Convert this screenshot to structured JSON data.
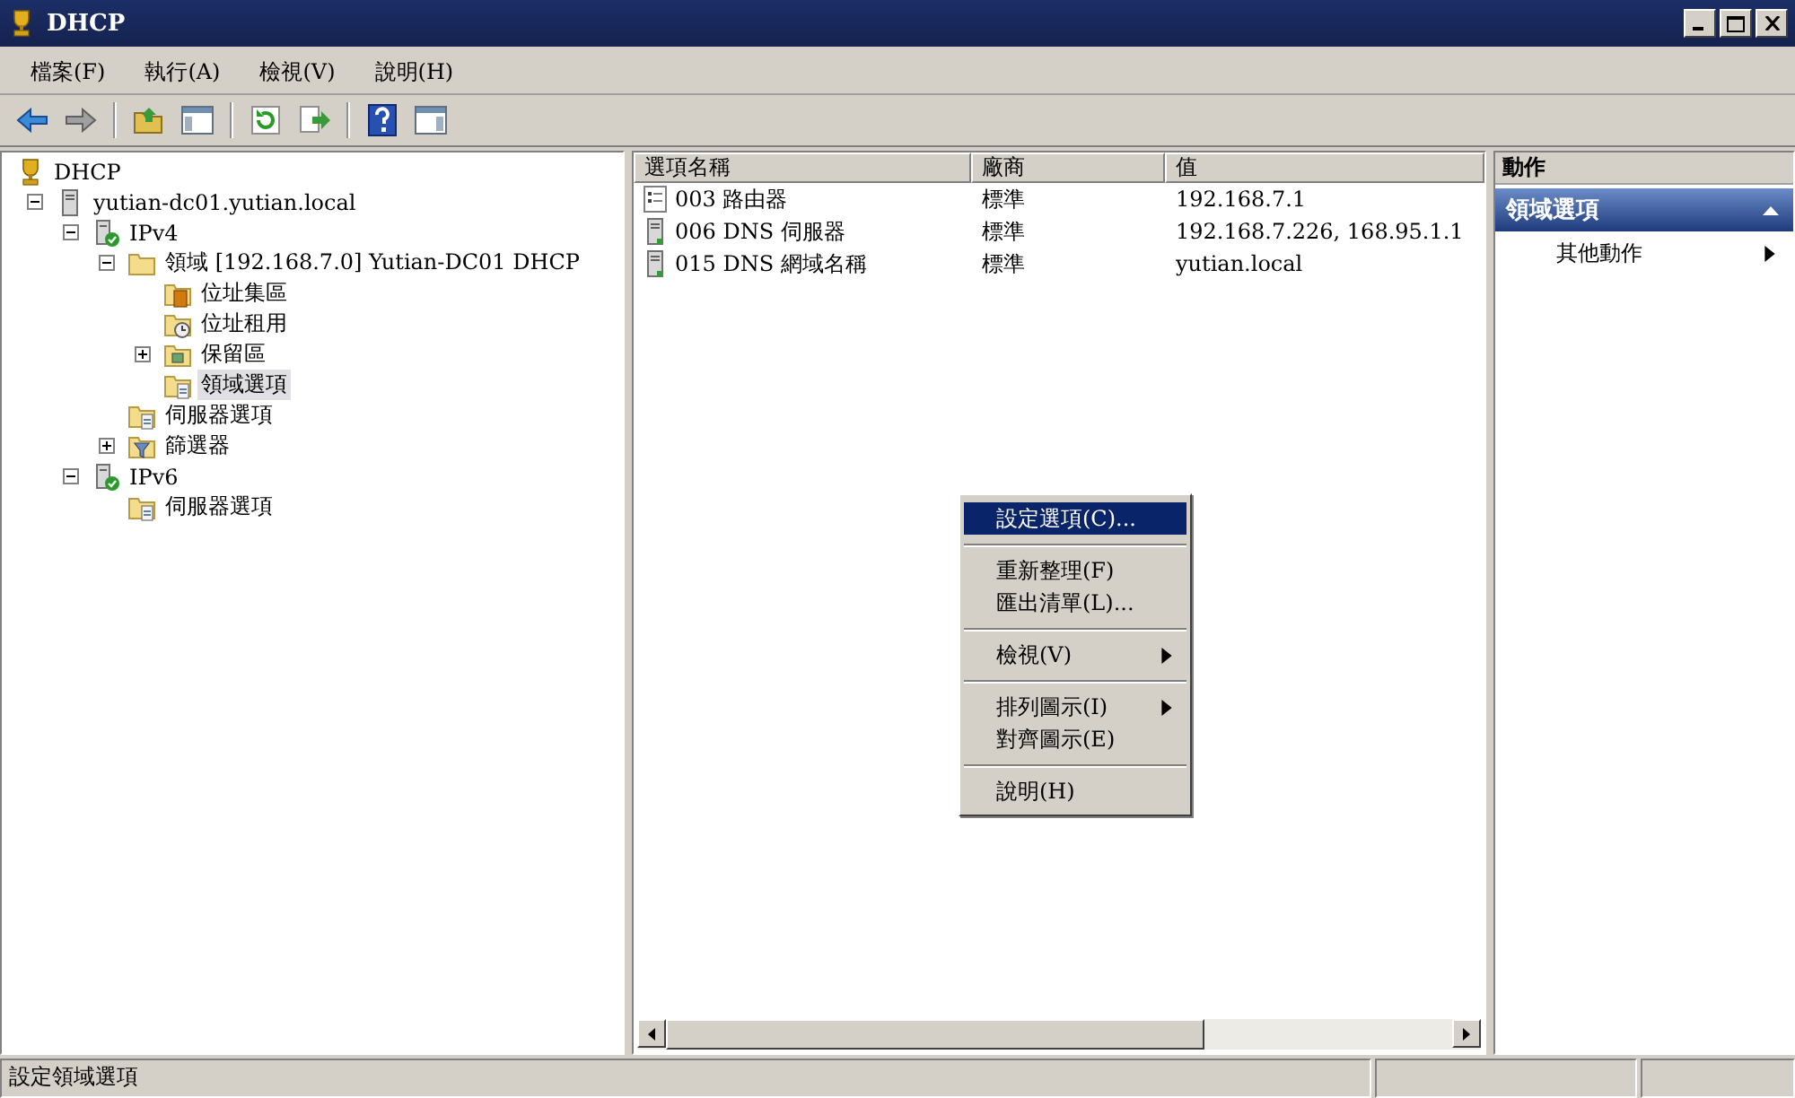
{
  "window": {
    "title": "DHCP"
  },
  "menu": [
    "檔案(F)",
    "執行(A)",
    "檢視(V)",
    "說明(H)"
  ],
  "tree": [
    {
      "label": "DHCP",
      "kind": "root",
      "selected": false,
      "children": [
        {
          "label": "yutian-dc01.yutian.local",
          "kind": "server",
          "selected": false,
          "expanded": true,
          "children": [
            {
              "label": "IPv4",
              "kind": "protocol",
              "selected": false,
              "expanded": true,
              "children": [
                {
                  "label": "領域 [192.168.7.0] Yutian-DC01 DHCP",
                  "kind": "scope",
                  "selected": false,
                  "expanded": true,
                  "children": [
                    {
                      "label": "位址集區",
                      "kind": "pool",
                      "selected": false
                    },
                    {
                      "label": "位址租用",
                      "kind": "leases",
                      "selected": false
                    },
                    {
                      "label": "保留區",
                      "kind": "reservations",
                      "selected": false,
                      "expanded": false
                    },
                    {
                      "label": "領域選項",
                      "kind": "options",
                      "selected": true
                    }
                  ]
                },
                {
                  "label": "伺服器選項",
                  "kind": "options",
                  "selected": false
                },
                {
                  "label": "篩選器",
                  "kind": "filters",
                  "selected": false,
                  "expanded": false
                }
              ]
            },
            {
              "label": "IPv6",
              "kind": "protocol",
              "selected": false,
              "expanded": true,
              "children": [
                {
                  "label": "伺服器選項",
                  "kind": "options",
                  "selected": false
                }
              ]
            }
          ]
        }
      ]
    }
  ],
  "table": {
    "columns": [
      "選項名稱",
      "廠商",
      "值"
    ],
    "rows": [
      {
        "kind": "list",
        "cells": [
          "003 路由器",
          "標準",
          "192.168.7.1"
        ]
      },
      {
        "kind": "server",
        "cells": [
          "006 DNS 伺服器",
          "標準",
          "192.168.7.226, 168.95.1.1"
        ]
      },
      {
        "kind": "server",
        "cells": [
          "015 DNS 網域名稱",
          "標準",
          "yutian.local"
        ]
      }
    ]
  },
  "context_menu": {
    "groups": [
      [
        {
          "label": "設定選項(C)...",
          "selected": true,
          "submenu": false
        }
      ],
      [
        {
          "label": "重新整理(F)",
          "selected": false,
          "submenu": false
        },
        {
          "label": "匯出清單(L)...",
          "selected": false,
          "submenu": false
        }
      ],
      [
        {
          "label": "檢視(V)",
          "selected": false,
          "submenu": true
        }
      ],
      [
        {
          "label": "排列圖示(I)",
          "selected": false,
          "submenu": true
        },
        {
          "label": "對齊圖示(E)",
          "selected": false,
          "submenu": false
        }
      ],
      [
        {
          "label": "說明(H)",
          "selected": false,
          "submenu": false
        }
      ]
    ]
  },
  "actions": {
    "title": "動作",
    "section": {
      "label": "領域選項",
      "expanded": true
    },
    "items": [
      {
        "label": "其他動作",
        "submenu": true
      }
    ]
  },
  "status_bar": {
    "text": "設定領域選項"
  }
}
